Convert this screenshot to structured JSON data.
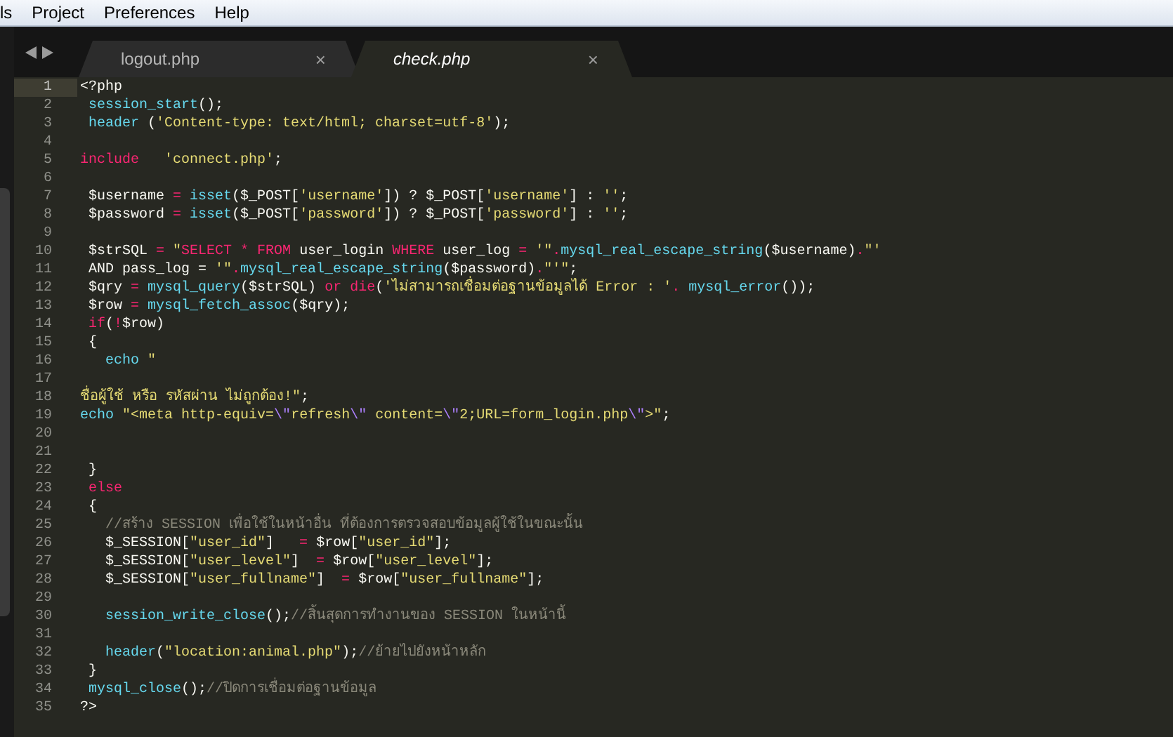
{
  "menu": [
    "ls",
    "Project",
    "Preferences",
    "Help"
  ],
  "tabs": [
    {
      "label": "logout.php",
      "close": "×",
      "selected": false
    },
    {
      "label": "check.php",
      "close": "×",
      "selected": true
    }
  ],
  "lines": [
    {
      "number": "1",
      "selected": true,
      "tokens": [
        {
          "text": "<?php",
          "kind": "plain"
        }
      ]
    },
    {
      "number": "2",
      "selected": false,
      "tokens": [
        {
          "text": " session_start",
          "kind": "fn"
        },
        {
          "text": "();",
          "kind": "plain"
        }
      ]
    },
    {
      "number": "3",
      "selected": false,
      "tokens": [
        {
          "text": " header",
          "kind": "fn"
        },
        {
          "text": " (",
          "kind": "plain"
        },
        {
          "text": "'Content-type: text/html; charset=utf-8'",
          "kind": "str"
        },
        {
          "text": ");",
          "kind": "plain"
        }
      ]
    },
    {
      "number": "4",
      "selected": false
    },
    {
      "number": "5",
      "selected": false,
      "tokens": [
        {
          "text": "include",
          "kind": "kw"
        },
        {
          "text": "   'connect.php'",
          "kind": "str"
        },
        {
          "text": ";",
          "kind": "plain"
        }
      ]
    },
    {
      "number": "6",
      "selected": false
    },
    {
      "number": "7",
      "selected": false,
      "tokens": [
        {
          "text": " $username ",
          "kind": "plain"
        },
        {
          "text": "=",
          "kind": "kw"
        },
        {
          "text": " isset",
          "kind": "fn"
        },
        {
          "text": "($_POST[",
          "kind": "plain"
        },
        {
          "text": "'username'",
          "kind": "str"
        },
        {
          "text": "]) ? $_POST[",
          "kind": "plain"
        },
        {
          "text": "'username'",
          "kind": "str"
        },
        {
          "text": "] : ",
          "kind": "plain"
        },
        {
          "text": "''",
          "kind": "str"
        },
        {
          "text": ";",
          "kind": "plain"
        }
      ]
    },
    {
      "number": "8",
      "selected": false,
      "tokens": [
        {
          "text": " $password ",
          "kind": "plain"
        },
        {
          "text": "=",
          "kind": "kw"
        },
        {
          "text": " isset",
          "kind": "fn"
        },
        {
          "text": "($_POST[",
          "kind": "plain"
        },
        {
          "text": "'password'",
          "kind": "str"
        },
        {
          "text": "]) ? $_POST[",
          "kind": "plain"
        },
        {
          "text": "'password'",
          "kind": "str"
        },
        {
          "text": "] : ",
          "kind": "plain"
        },
        {
          "text": "''",
          "kind": "str"
        },
        {
          "text": ";",
          "kind": "plain"
        }
      ]
    },
    {
      "number": "9",
      "selected": false
    },
    {
      "number": "10",
      "selected": false,
      "tokens": [
        {
          "text": " $strSQL ",
          "kind": "plain"
        },
        {
          "text": "=",
          "kind": "kw"
        },
        {
          "text": " \"",
          "kind": "str"
        },
        {
          "text": "SELECT * FROM",
          "kind": "kw"
        },
        {
          "text": " user_login ",
          "kind": "plain"
        },
        {
          "text": "WHERE",
          "kind": "kw"
        },
        {
          "text": " user_log ",
          "kind": "plain"
        },
        {
          "text": "=",
          "kind": "kw"
        },
        {
          "text": " '\"",
          "kind": "str"
        },
        {
          "text": ".",
          "kind": "kw"
        },
        {
          "text": "mysql_real_escape_string",
          "kind": "fn"
        },
        {
          "text": "($username)",
          "kind": "plain"
        },
        {
          "text": ".",
          "kind": "kw"
        },
        {
          "text": "\"'",
          "kind": "str"
        }
      ]
    },
    {
      "number": "11",
      "selected": false,
      "tokens": [
        {
          "text": " AND pass_log = ",
          "kind": "plain"
        },
        {
          "text": "'\"",
          "kind": "str"
        },
        {
          "text": ".",
          "kind": "kw"
        },
        {
          "text": "mysql_real_escape_string",
          "kind": "fn"
        },
        {
          "text": "($password)",
          "kind": "plain"
        },
        {
          "text": ".",
          "kind": "kw"
        },
        {
          "text": "\"'\"",
          "kind": "str"
        },
        {
          "text": ";",
          "kind": "plain"
        }
      ]
    },
    {
      "number": "12",
      "selected": false,
      "tokens": [
        {
          "text": " $qry ",
          "kind": "plain"
        },
        {
          "text": "=",
          "kind": "kw"
        },
        {
          "text": " mysql_query",
          "kind": "fn"
        },
        {
          "text": "($strSQL) ",
          "kind": "plain"
        },
        {
          "text": "or die",
          "kind": "kw"
        },
        {
          "text": "(",
          "kind": "plain"
        },
        {
          "text": "'ไม่สามารถเชื่อมต่อฐานข้อมูลได้ Error : '",
          "kind": "str"
        },
        {
          "text": ".",
          "kind": "kw"
        },
        {
          "text": " mysql_error",
          "kind": "fn"
        },
        {
          "text": "());",
          "kind": "plain"
        }
      ]
    },
    {
      "number": "13",
      "selected": false,
      "tokens": [
        {
          "text": " $row ",
          "kind": "plain"
        },
        {
          "text": "=",
          "kind": "kw"
        },
        {
          "text": " mysql_fetch_assoc",
          "kind": "fn"
        },
        {
          "text": "($qry);",
          "kind": "plain"
        }
      ]
    },
    {
      "number": "14",
      "selected": false,
      "tokens": [
        {
          "text": " if",
          "kind": "kw"
        },
        {
          "text": "(",
          "kind": "plain"
        },
        {
          "text": "!",
          "kind": "kw"
        },
        {
          "text": "$row)",
          "kind": "plain"
        }
      ]
    },
    {
      "number": "15",
      "selected": false,
      "tokens": [
        {
          "text": " {",
          "kind": "plain"
        }
      ]
    },
    {
      "number": "16",
      "selected": false,
      "tokens": [
        {
          "text": "   echo",
          "kind": "fn"
        },
        {
          "text": " \"",
          "kind": "str"
        }
      ]
    },
    {
      "number": "17",
      "selected": false
    },
    {
      "number": "18",
      "selected": false,
      "tokens": [
        {
          "text": "ชื่อผู้ใช้ หรือ รหัสผ่าน ไม่ถูกต้อง!\"",
          "kind": "str"
        },
        {
          "text": ";",
          "kind": "plain"
        }
      ]
    },
    {
      "number": "19",
      "selected": false,
      "tokens": [
        {
          "text": "echo",
          "kind": "fn"
        },
        {
          "text": " \"<meta http-equiv=",
          "kind": "str"
        },
        {
          "text": "\\\"",
          "kind": "esc"
        },
        {
          "text": "refresh",
          "kind": "str"
        },
        {
          "text": "\\\"",
          "kind": "esc"
        },
        {
          "text": " content=",
          "kind": "str"
        },
        {
          "text": "\\\"",
          "kind": "esc"
        },
        {
          "text": "2;URL=form_login.php",
          "kind": "str"
        },
        {
          "text": "\\\"",
          "kind": "esc"
        },
        {
          "text": ">\"",
          "kind": "str"
        },
        {
          "text": ";",
          "kind": "plain"
        }
      ]
    },
    {
      "number": "20",
      "selected": false
    },
    {
      "number": "21",
      "selected": false
    },
    {
      "number": "22",
      "selected": false,
      "tokens": [
        {
          "text": " }",
          "kind": "plain"
        }
      ]
    },
    {
      "number": "23",
      "selected": false,
      "tokens": [
        {
          "text": " else",
          "kind": "kw"
        }
      ]
    },
    {
      "number": "24",
      "selected": false,
      "tokens": [
        {
          "text": " {",
          "kind": "plain"
        }
      ]
    },
    {
      "number": "25",
      "selected": false,
      "tokens": [
        {
          "text": "   //สร้าง SESSION เพื่อใช้ในหน้าอื่น ที่ต้องการตรวจสอบข้อมูลผู้ใช้ในขณะนั้น",
          "kind": "comment"
        }
      ]
    },
    {
      "number": "26",
      "selected": false,
      "tokens": [
        {
          "text": "   $_SESSION[",
          "kind": "plain"
        },
        {
          "text": "\"user_id\"",
          "kind": "str"
        },
        {
          "text": "]   ",
          "kind": "plain"
        },
        {
          "text": "=",
          "kind": "kw"
        },
        {
          "text": " $row[",
          "kind": "plain"
        },
        {
          "text": "\"user_id\"",
          "kind": "str"
        },
        {
          "text": "];",
          "kind": "plain"
        }
      ]
    },
    {
      "number": "27",
      "selected": false,
      "tokens": [
        {
          "text": "   $_SESSION[",
          "kind": "plain"
        },
        {
          "text": "\"user_level\"",
          "kind": "str"
        },
        {
          "text": "]  ",
          "kind": "plain"
        },
        {
          "text": "=",
          "kind": "kw"
        },
        {
          "text": " $row[",
          "kind": "plain"
        },
        {
          "text": "\"user_level\"",
          "kind": "str"
        },
        {
          "text": "];",
          "kind": "plain"
        }
      ]
    },
    {
      "number": "28",
      "selected": false,
      "tokens": [
        {
          "text": "   $_SESSION[",
          "kind": "plain"
        },
        {
          "text": "\"user_fullname\"",
          "kind": "str"
        },
        {
          "text": "]  ",
          "kind": "plain"
        },
        {
          "text": "=",
          "kind": "kw"
        },
        {
          "text": " $row[",
          "kind": "plain"
        },
        {
          "text": "\"user_fullname\"",
          "kind": "str"
        },
        {
          "text": "];",
          "kind": "plain"
        }
      ]
    },
    {
      "number": "29",
      "selected": false
    },
    {
      "number": "30",
      "selected": false,
      "tokens": [
        {
          "text": "   session_write_close",
          "kind": "fn"
        },
        {
          "text": "();",
          "kind": "plain"
        },
        {
          "text": "//สิ้นสุดการทำงานของ SESSION ในหน้านี้",
          "kind": "comment"
        }
      ]
    },
    {
      "number": "31",
      "selected": false
    },
    {
      "number": "32",
      "selected": false,
      "tokens": [
        {
          "text": "   header",
          "kind": "fn"
        },
        {
          "text": "(",
          "kind": "plain"
        },
        {
          "text": "\"location:animal.php\"",
          "kind": "str"
        },
        {
          "text": ");",
          "kind": "plain"
        },
        {
          "text": "//ย้ายไปยังหน้าหลัก",
          "kind": "comment"
        }
      ]
    },
    {
      "number": "33",
      "selected": false,
      "tokens": [
        {
          "text": " }",
          "kind": "plain"
        }
      ]
    },
    {
      "number": "34",
      "selected": false,
      "tokens": [
        {
          "text": " mysql_close",
          "kind": "fn"
        },
        {
          "text": "();",
          "kind": "plain"
        },
        {
          "text": "//ปิดการเชื่อมต่อฐานข้อมูล",
          "kind": "comment"
        }
      ]
    },
    {
      "number": "35",
      "selected": false,
      "tokens": [
        {
          "text": "?>",
          "kind": "plain"
        }
      ]
    }
  ]
}
